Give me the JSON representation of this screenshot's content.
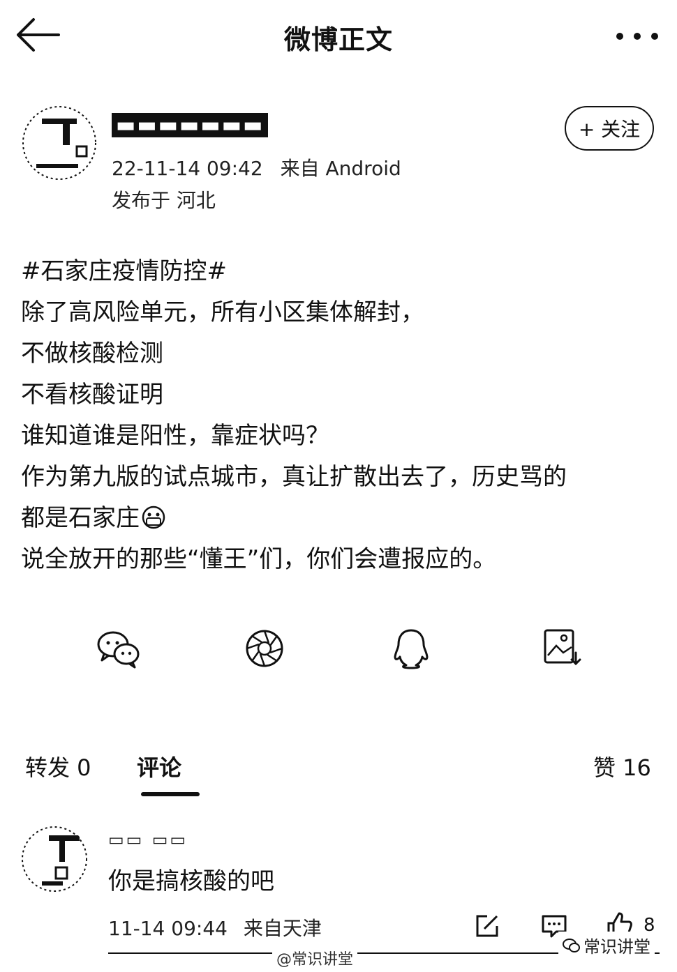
{
  "header": {
    "title": "微博正文",
    "back_icon": "arrow-left-icon",
    "more_icon": "more-dots-icon"
  },
  "post": {
    "author_name": "▬▬▬▬▬▬▬",
    "date": "22-11-14 09:42",
    "source": "来自 Android",
    "location": "发布于 河北",
    "follow_label": "+ 关注",
    "lines": [
      "#石家庄疫情防控#",
      "除了高风险单元，所有小区集体解封，",
      "不做核酸检测",
      "不看核酸证明",
      "谁知道谁是阳性，靠症状吗？",
      "作为第九版的试点城市，真让扩散出去了，历史骂的",
      "都是石家庄",
      "说全放开的那些“懂王”们，你们会遭报应的。"
    ],
    "emoji_icon": "mask-face-emoji-icon"
  },
  "share": {
    "icons": [
      "wechat-icon",
      "moments-icon",
      "qq-icon",
      "save-image-icon"
    ]
  },
  "stats": {
    "reposts_label": "转发 0",
    "comments_label": "评论",
    "likes_label": "赞 16"
  },
  "comment": {
    "user_name": "▭▭ ▭▭",
    "text": "你是搞核酸的吧",
    "time": "11-14 09:44",
    "from": "来自天津",
    "like_count": "8"
  },
  "watermark": {
    "left": "@常识讲堂",
    "right": "常识讲堂"
  }
}
